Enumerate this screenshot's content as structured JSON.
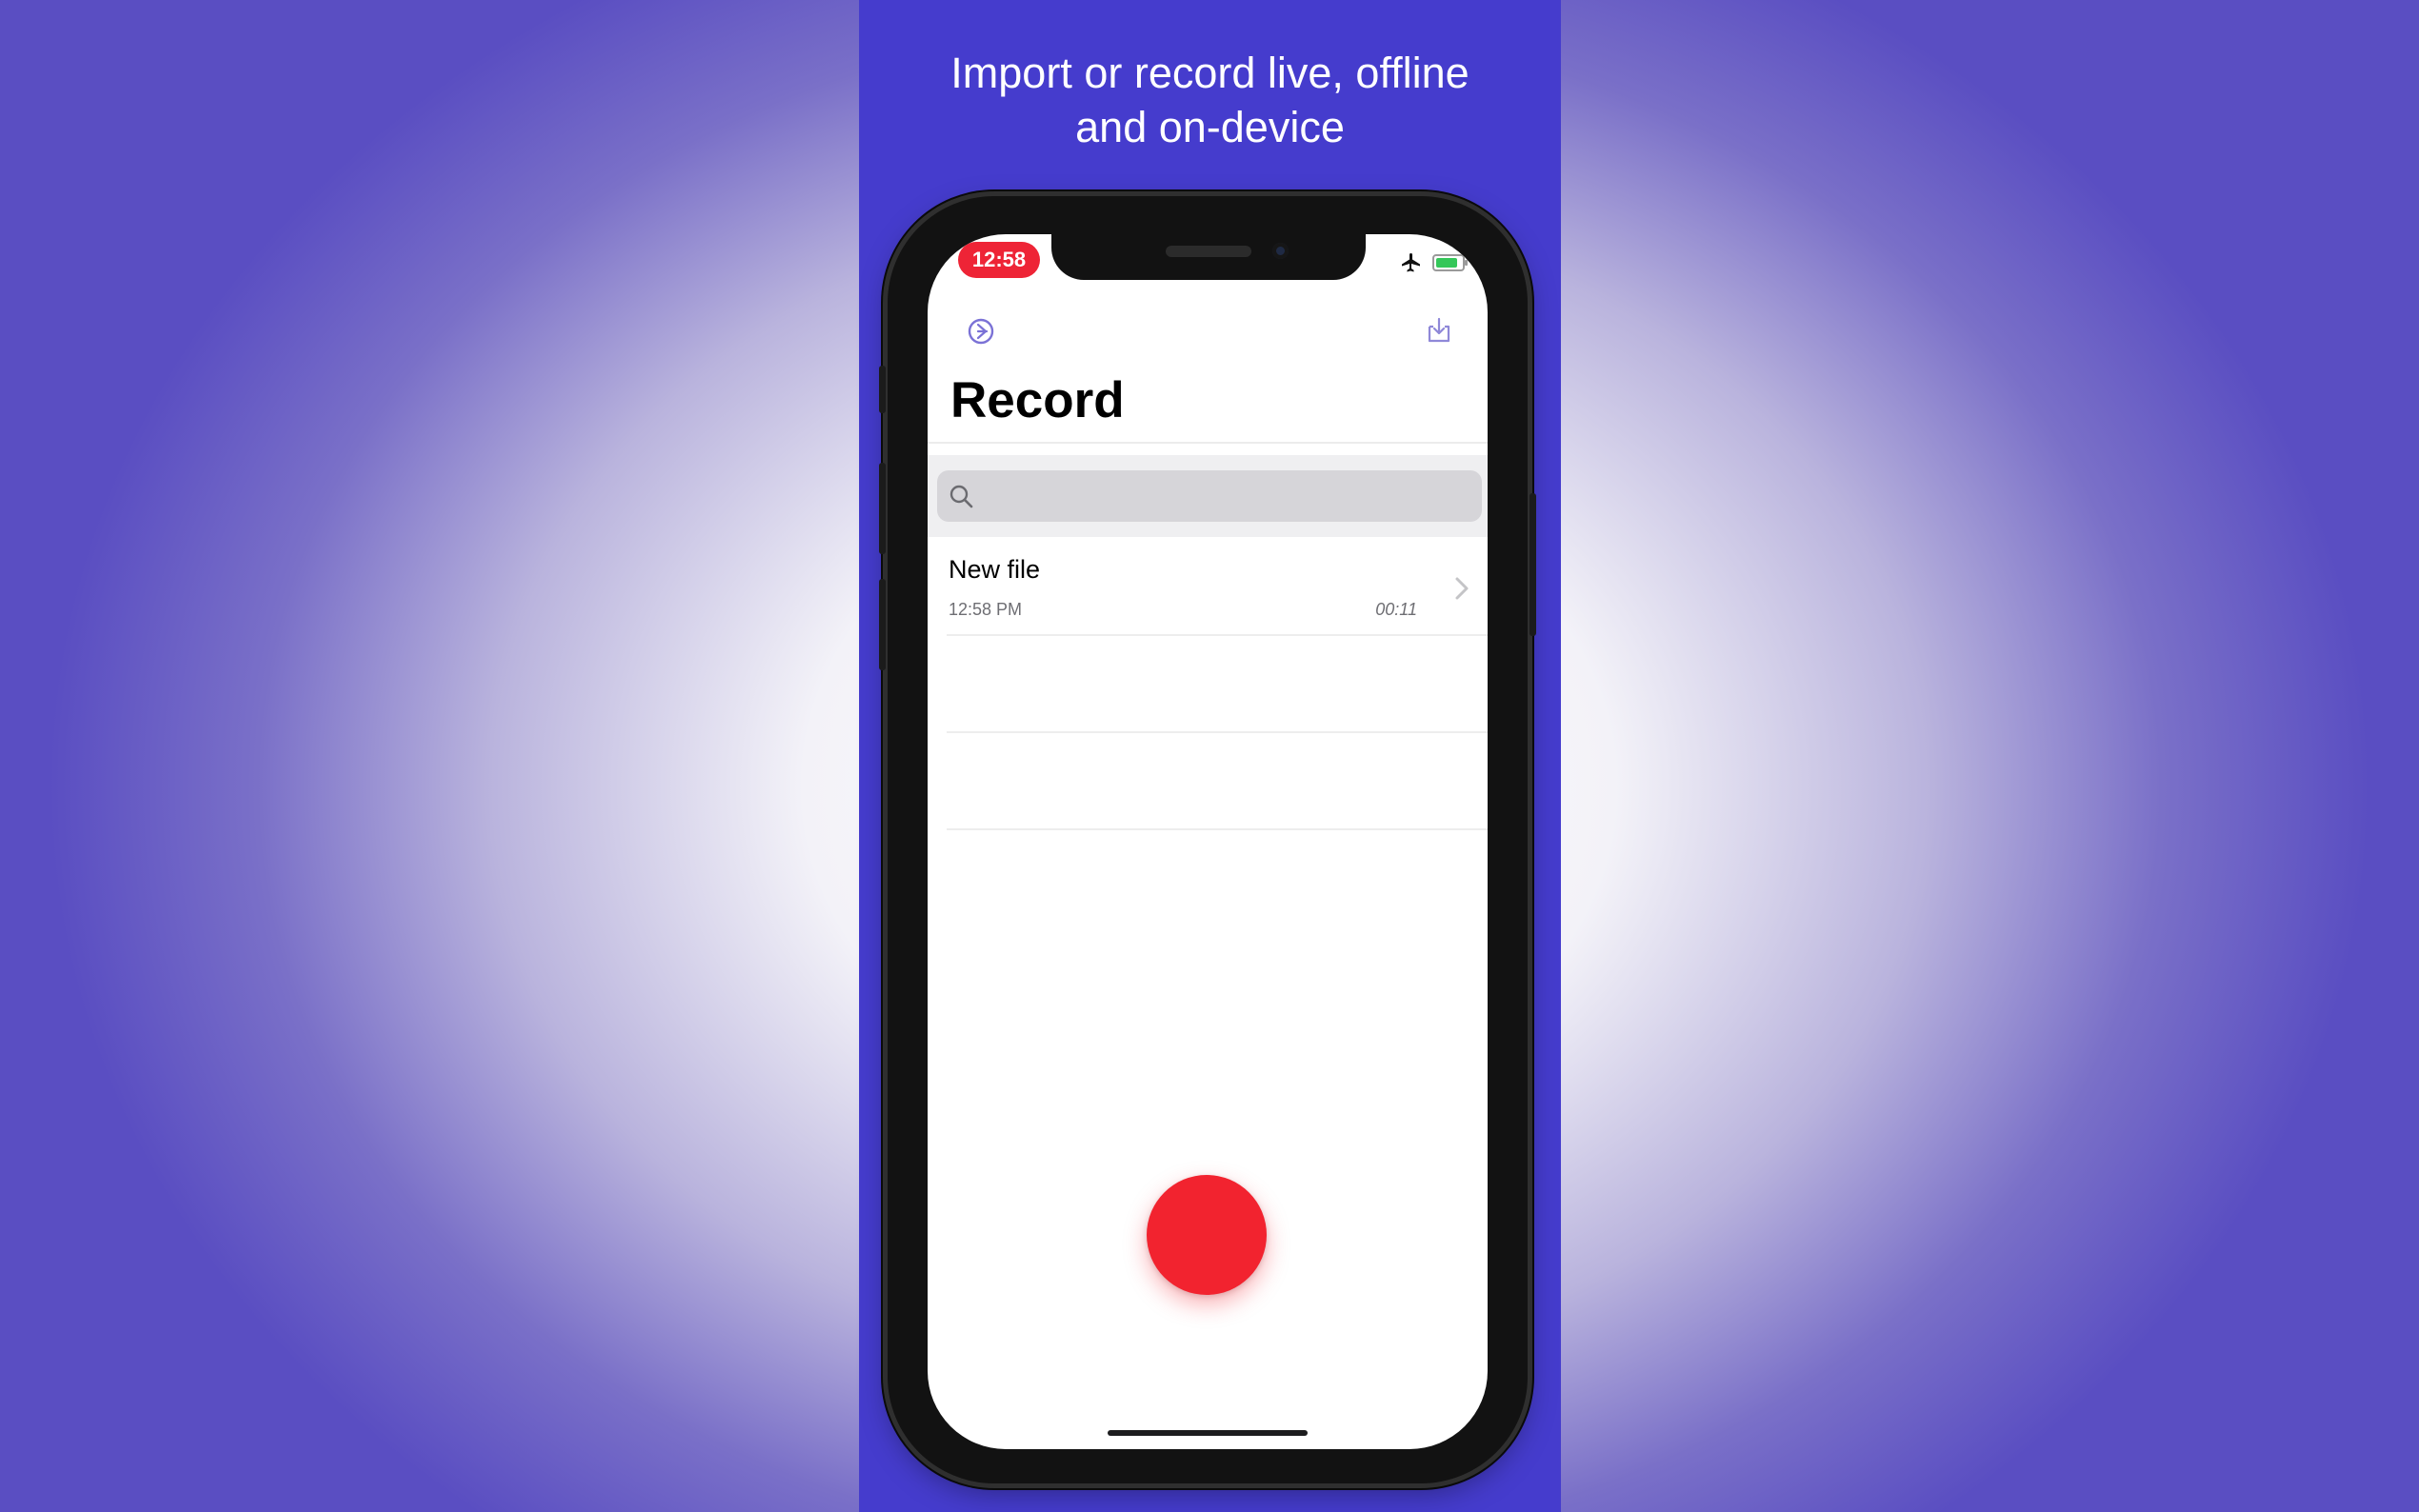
{
  "headline": {
    "line1": "Import or record live, offline",
    "line2": "and on-device"
  },
  "status_bar": {
    "time": "12:58",
    "icons": [
      "airplane-icon",
      "battery-charging-icon"
    ]
  },
  "nav": {
    "left_icon": "settings-compass-icon",
    "right_icon": "import-tray-icon",
    "title": "Record"
  },
  "search": {
    "icon": "search-icon",
    "placeholder": ""
  },
  "recordings": [
    {
      "title": "New file",
      "date": "12:58 PM",
      "duration": "00:11"
    }
  ],
  "record_button": {
    "icon": "record-dot",
    "color": "#f2232f"
  },
  "colors": {
    "panel": "#453ccd",
    "accent": "#7b72d6",
    "record": "#f2232f",
    "time_pill": "#ee2436"
  }
}
